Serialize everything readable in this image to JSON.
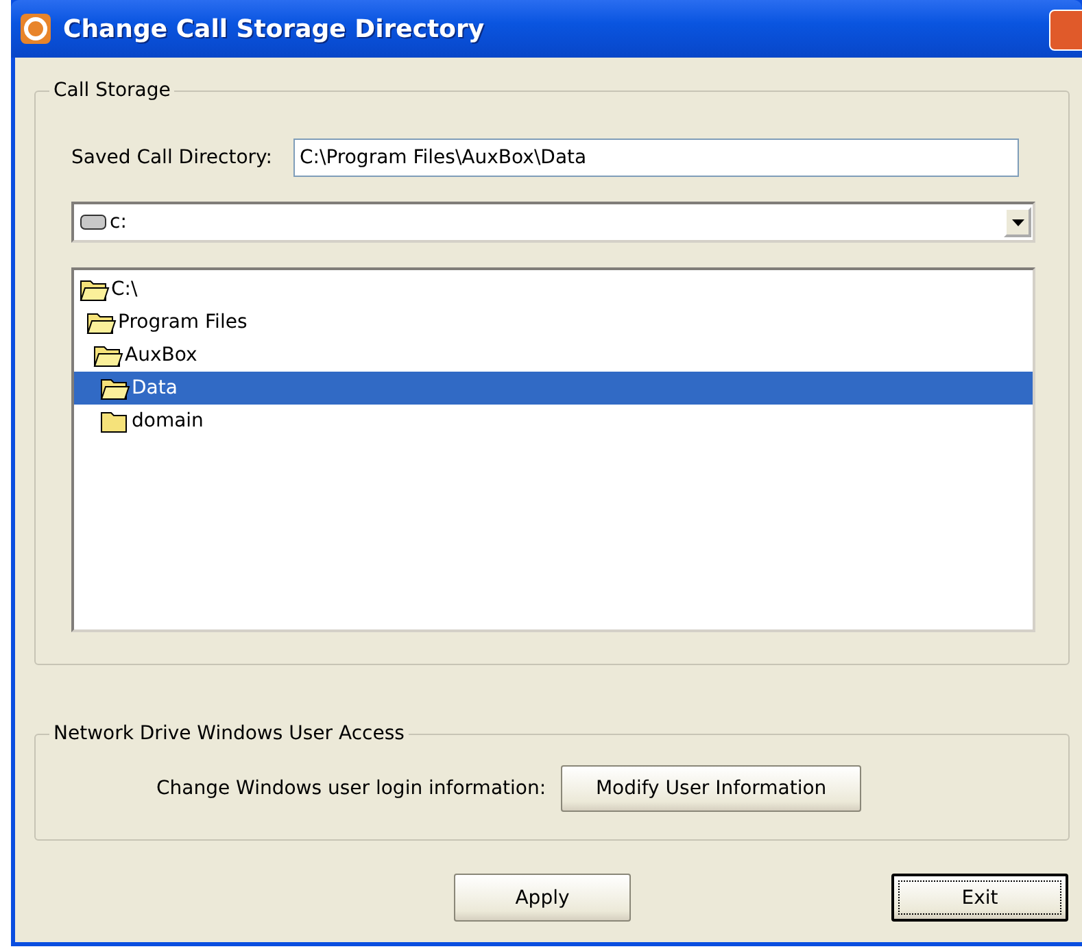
{
  "window": {
    "title": "Change Call Storage Directory"
  },
  "call_storage": {
    "legend": "Call Storage",
    "directory_label": "Saved Call Directory:",
    "directory_value": "C:\\Program Files\\AuxBox\\Data",
    "drive": "c:",
    "tree": [
      {
        "label": "C:\\",
        "expanded": true,
        "selected": false,
        "children": [
          {
            "label": "Program Files",
            "expanded": true,
            "selected": false,
            "children": [
              {
                "label": "AuxBox",
                "expanded": true,
                "selected": false,
                "children": [
                  {
                    "label": "Data",
                    "expanded": true,
                    "selected": true
                  },
                  {
                    "label": "domain",
                    "expanded": false,
                    "selected": false
                  }
                ]
              }
            ]
          }
        ]
      }
    ]
  },
  "network_access": {
    "legend": "Network Drive Windows User Access",
    "label": "Change Windows user login information:",
    "button": "Modify User Information"
  },
  "buttons": [
    {
      "label": "Apply",
      "default": false
    },
    {
      "label": "Exit",
      "default": true
    }
  ]
}
